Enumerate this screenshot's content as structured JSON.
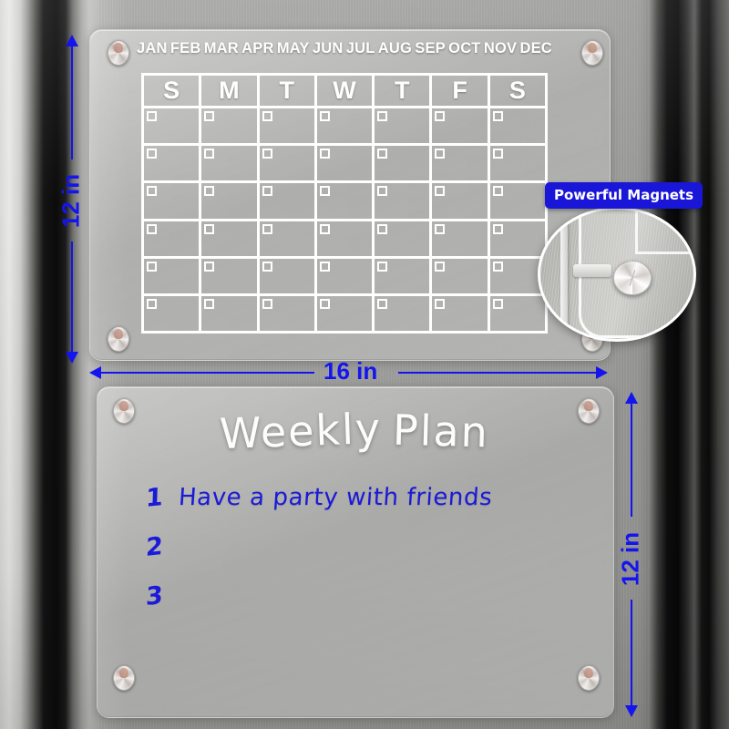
{
  "product": {
    "calendar_board": {
      "months": [
        "JAN",
        "FEB",
        "MAR",
        "APR",
        "MAY",
        "JUN",
        "JUL",
        "AUG",
        "SEP",
        "OCT",
        "NOV",
        "DEC"
      ],
      "days_of_week": [
        "S",
        "M",
        "T",
        "W",
        "T",
        "F",
        "S"
      ],
      "week_rows": 6
    },
    "weekly_board": {
      "title_part1": "Weekly",
      "title_part2": "Plan",
      "items": [
        {
          "number": "1",
          "text": "Have a party with friends"
        },
        {
          "number": "2",
          "text": ""
        },
        {
          "number": "3",
          "text": ""
        }
      ]
    },
    "dimensions": {
      "calendar_height": "12 in",
      "calendar_width": "16 in",
      "weekly_height": "12 in"
    },
    "callout": {
      "badge": "Powerful Magnets"
    },
    "colors": {
      "annotation_blue": "#1414ef",
      "badge_blue": "#1a16d8",
      "handwriting_blue": "#1a1ad8",
      "board_white": "#ffffff"
    }
  }
}
